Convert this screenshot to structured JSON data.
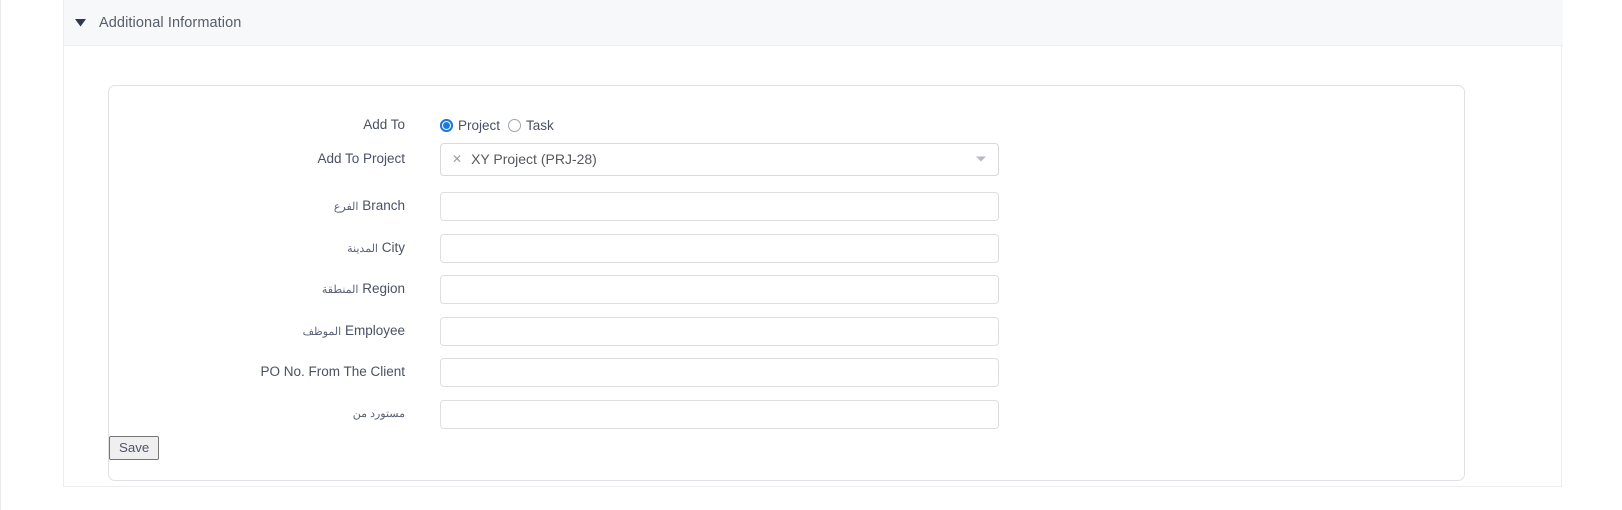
{
  "section": {
    "title": "Additional Information",
    "caret_icon": "caret-down-icon",
    "expanded": true
  },
  "form": {
    "rows": [
      {
        "key": "add_to",
        "label_en": "Add To",
        "label_ar": "",
        "type": "radio",
        "options": [
          {
            "label": "Project",
            "checked": true
          },
          {
            "label": "Task",
            "checked": false
          }
        ]
      },
      {
        "key": "add_to_project",
        "label_en": "Add To Project",
        "label_ar": "",
        "type": "select",
        "value": "XY Project (PRJ-28)",
        "clear_icon": "remove-tag-icon",
        "arrow_icon": "chevron-down-icon"
      },
      {
        "key": "branch",
        "label_en": "Branch",
        "label_ar": "الفرع",
        "type": "text",
        "value": "",
        "placeholder": ""
      },
      {
        "key": "city",
        "label_en": "City",
        "label_ar": "المدينة",
        "type": "text",
        "value": "",
        "placeholder": ""
      },
      {
        "key": "region",
        "label_en": "Region",
        "label_ar": "المنطقة",
        "type": "text",
        "value": "",
        "placeholder": ""
      },
      {
        "key": "employee",
        "label_en": "Employee",
        "label_ar": "الموظف",
        "type": "text",
        "value": "",
        "placeholder": ""
      },
      {
        "key": "po_no_from_client",
        "label_en": "PO No. From The Client",
        "label_ar": "",
        "type": "text",
        "value": "",
        "placeholder": ""
      },
      {
        "key": "imported_from",
        "label_en": "",
        "label_ar": "مستورد من",
        "type": "text",
        "value": "",
        "placeholder": ""
      }
    ],
    "save_label": "Save"
  },
  "colors": {
    "header_bg": "#f7f8f9",
    "accent": "#1f7ae0",
    "label_text": "#4a5163",
    "border": "#dfe1e4",
    "button_bg": "#efefef"
  }
}
